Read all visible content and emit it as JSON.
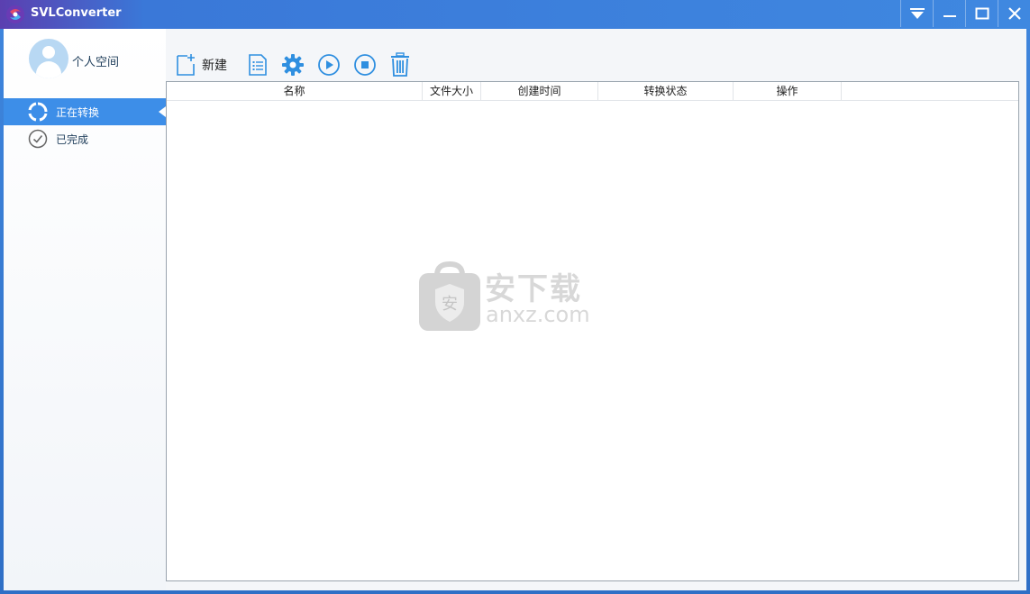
{
  "window": {
    "title": "SVLConverter"
  },
  "profile": {
    "label": "个人空间"
  },
  "sidebar": {
    "items": [
      {
        "label": "正在转换",
        "active": true
      },
      {
        "label": "已完成",
        "active": false
      }
    ]
  },
  "toolbar": {
    "new_label": "新建"
  },
  "table": {
    "columns": [
      "名称",
      "文件大小",
      "创建时间",
      "转换状态",
      "操作"
    ],
    "rows": []
  },
  "watermark": {
    "cn": "安下载",
    "en": "anxz.com",
    "badge": "安"
  },
  "colors": {
    "titlebar": "#3f88e0",
    "accent": "#3d8ee8",
    "icon_blue": "#2f8fe0"
  }
}
